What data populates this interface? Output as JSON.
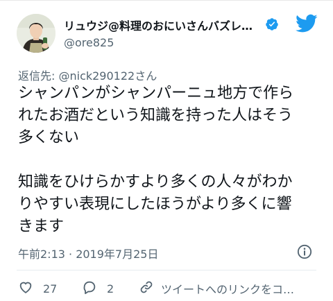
{
  "tweet": {
    "display_name": "リュウジ@料理のおにいさんバズレ…",
    "handle": "@ore825",
    "reply_to": "返信先: @nick290122さん",
    "text_lines": [
      "シャンパンがシャンパーニュ地方で作ら",
      "れたお酒だという知識を持った人はそう",
      "多くない",
      "",
      "知識をひけらかすより多くの人々がわか",
      "りやすい表現にしたほうがより多くに響",
      "きます"
    ],
    "timestamp": "午前2:13 · 2019年7月25日"
  },
  "actions": {
    "like_count": "27",
    "reply_count": "2",
    "share_label": "ツイートへのリンクをコ…"
  },
  "icons": {
    "avatar": "user-avatar",
    "verified": "verified-badge-icon",
    "logo": "twitter-bird-icon",
    "info": "info-icon",
    "like": "heart-icon",
    "reply": "reply-bubble-icon",
    "link": "link-icon"
  },
  "colors": {
    "twitter_blue": "#1d9bf0",
    "text_primary": "#0f1419",
    "text_secondary": "#536471"
  }
}
